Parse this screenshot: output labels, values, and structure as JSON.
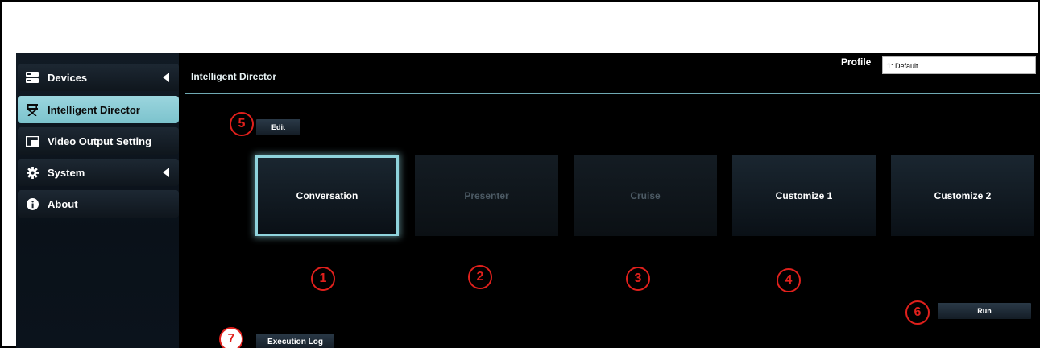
{
  "sidebar": {
    "items": [
      {
        "label": "Devices",
        "icon": "server-icon",
        "has_arrow": true
      },
      {
        "label": "Intelligent Director",
        "icon": "director-chair-icon",
        "active": true
      },
      {
        "label": "Video Output Setting",
        "icon": "video-output-icon"
      },
      {
        "label": "System",
        "icon": "gear-icon",
        "has_arrow": true
      },
      {
        "label": "About",
        "icon": "info-icon"
      }
    ]
  },
  "header": {
    "title": "Intelligent Director",
    "profile_label": "Profile",
    "profile_value": "1: Default"
  },
  "toolbar": {
    "edit_label": "Edit",
    "run_label": "Run",
    "log_label": "Execution Log"
  },
  "modes": [
    {
      "label": "Conversation",
      "selected": true,
      "enabled": true
    },
    {
      "label": "Presenter",
      "enabled": false
    },
    {
      "label": "Cruise",
      "enabled": false
    },
    {
      "label": "Customize 1",
      "enabled": true
    },
    {
      "label": "Customize 2",
      "enabled": true
    }
  ],
  "callouts": [
    "1",
    "2",
    "3",
    "4",
    "5",
    "6",
    "7"
  ],
  "colors": {
    "accent": "#8fd3dc",
    "active_item": "#9bd5de",
    "callout": "#e0201c",
    "background": "#000000"
  }
}
